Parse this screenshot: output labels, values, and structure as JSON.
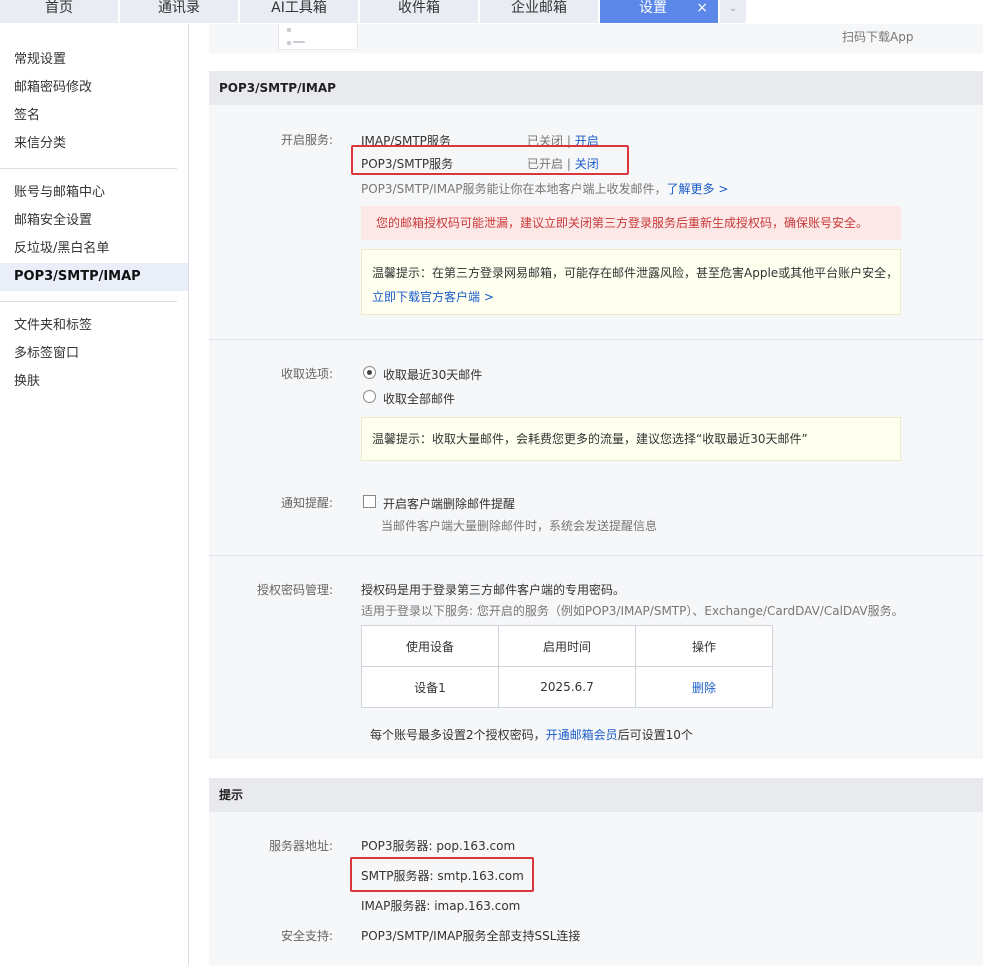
{
  "tabs": [
    {
      "label": "首页"
    },
    {
      "label": "通讯录"
    },
    {
      "label": "AI工具箱"
    },
    {
      "label": "收件箱"
    },
    {
      "label": "企业邮箱"
    },
    {
      "label": "设置",
      "close": "×"
    }
  ],
  "sidebar": {
    "groups": [
      [
        "常规设置",
        "邮箱密码修改",
        "签名",
        "来信分类"
      ],
      [
        "账号与邮箱中心",
        "邮箱安全设置",
        "反垃圾/黑白名单",
        "POP3/SMTP/IMAP"
      ],
      [
        "文件夹和标签",
        "多标签窗口",
        "换肤"
      ]
    ],
    "active": "POP3/SMTP/IMAP"
  },
  "top_strip": {
    "app_download": "扫码下载App"
  },
  "pop_section": {
    "title": "POP3/SMTP/IMAP",
    "enable_label": "开启服务:",
    "services": [
      {
        "name": "IMAP/SMTP服务",
        "status": "已关闭",
        "sep": "|",
        "action": "开启"
      },
      {
        "name": "POP3/SMTP服务",
        "status": "已开启",
        "sep": "|",
        "action": "关闭"
      }
    ],
    "desc": "POP3/SMTP/IMAP服务能让你在本地客户端上收发邮件，",
    "learn_more": "了解更多 >",
    "alert": "您的邮箱授权码可能泄漏，建议立即关闭第三方登录服务后重新生成授权码，确保账号安全。",
    "tip1_line1": "温馨提示：在第三方登录网易邮箱，可能存在邮件泄露风险，甚至危害Apple或其他平台账户安全，",
    "tip1_link": "立即下载官方客户端 >",
    "receive_label": "收取选项:",
    "receive_options": [
      "收取最近30天邮件",
      "收取全部邮件"
    ],
    "tip2": "温馨提示：收取大量邮件，会耗费您更多的流量，建议您选择“收取最近30天邮件”",
    "notify_label": "通知提醒:",
    "notify_option": "开启客户端删除邮件提醒",
    "notify_desc": "当邮件客户端大量删除邮件时，系统会发送提醒信息",
    "auth_label": "授权密码管理:",
    "auth_desc1": "授权码是用于登录第三方邮件客户端的专用密码。",
    "auth_desc2": "适用于登录以下服务: 您开启的服务（例如POP3/IMAP/SMTP）、Exchange/CardDAV/CalDAV服务。",
    "table": {
      "headers": [
        "使用设备",
        "启用时间",
        "操作"
      ],
      "rows": [
        [
          "设备1",
          "2025.6.7",
          "删除"
        ]
      ]
    },
    "limit_prefix": "每个账号最多设置2个授权密码，",
    "limit_link": "开通邮箱会员",
    "limit_suffix": "后可设置10个"
  },
  "hint_section": {
    "title": "提示",
    "server_label": "服务器地址:",
    "servers": [
      "POP3服务器: pop.163.com",
      "SMTP服务器: smtp.163.com",
      "IMAP服务器: imap.163.com"
    ],
    "security_label": "安全支持:",
    "security_text": "POP3/SMTP/IMAP服务全部支持SSL连接"
  }
}
